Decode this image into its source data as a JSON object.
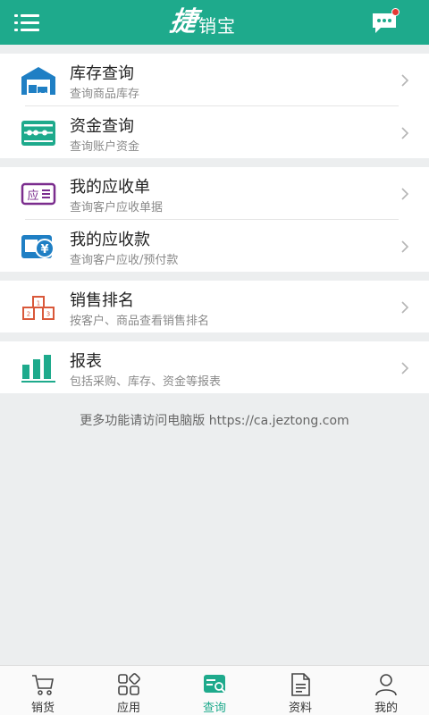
{
  "header": {
    "logo_big": "捷",
    "logo_small": "销宝"
  },
  "colors": {
    "primary": "#1eaa8c",
    "badge": "#e53935",
    "blue_icon": "#1f7fc4",
    "purple_icon": "#7b2d8e",
    "orange_icon": "#d9583a"
  },
  "groups": [
    {
      "items": [
        {
          "title": "库存查询",
          "sub": "查询商品库存",
          "icon": "warehouse-icon"
        },
        {
          "title": "资金查询",
          "sub": "查询账户资金",
          "icon": "abacus-icon"
        }
      ]
    },
    {
      "items": [
        {
          "title": "我的应收单",
          "sub": "查询客户应收单据",
          "icon": "receivable-doc-icon",
          "icon_text": "应"
        },
        {
          "title": "我的应收款",
          "sub": "查询客户应收/预付款",
          "icon": "wallet-icon",
          "icon_text": "¥"
        }
      ]
    },
    {
      "items": [
        {
          "title": "销售排名",
          "sub": "按客户、商品查看销售排名",
          "icon": "ranking-podium-icon"
        }
      ]
    },
    {
      "items": [
        {
          "title": "报表",
          "sub": "包括采购、库存、资金等报表",
          "icon": "bar-chart-icon"
        }
      ]
    }
  ],
  "footer_text": "更多功能请访问电脑版 https://ca.jeztong.com",
  "tabs": [
    {
      "label": "销货",
      "icon": "cart-icon",
      "active": false
    },
    {
      "label": "应用",
      "icon": "apps-icon",
      "active": false
    },
    {
      "label": "查询",
      "icon": "search-doc-icon",
      "active": true
    },
    {
      "label": "资料",
      "icon": "document-icon",
      "active": false
    },
    {
      "label": "我的",
      "icon": "user-icon",
      "active": false
    }
  ]
}
